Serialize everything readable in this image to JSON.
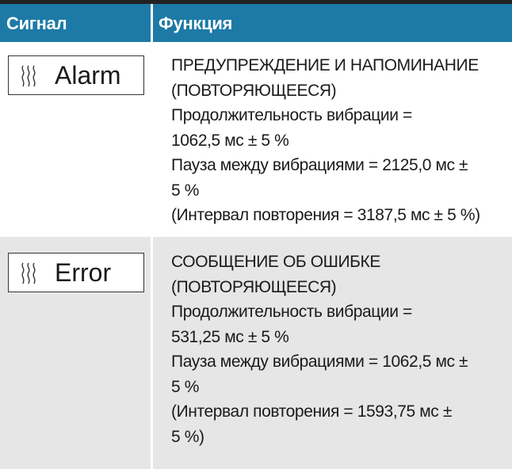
{
  "header": {
    "col_signal": "Сигнал",
    "col_function": "Функция"
  },
  "rows": [
    {
      "signal_icon": "vibration-icon",
      "signal_label": "Alarm",
      "lines": [
        "ПРЕДУПРЕЖДЕНИЕ И НАПОМИНАНИЕ",
        "(ПОВТОРЯЮЩЕЕСЯ)",
        "Продолжительность вибрации =",
        "1062,5 мс ± 5 %",
        "Пауза между вибрациями = 2125,0 мс ±",
        "5 %",
        "(Интервал повторения = 3187,5 мс ± 5 %)"
      ]
    },
    {
      "signal_icon": "vibration-icon",
      "signal_label": "Error",
      "lines": [
        "СООБЩЕНИЕ ОБ ОШИБКЕ",
        "(ПОВТОРЯЮЩЕЕСЯ)",
        "Продолжительность вибрации =",
        "531,25 мс ± 5 %",
        "Пауза между вибрациями = 1062,5 мс ±",
        "5 %",
        "(Интервал повторения = 1593,75 мс ±",
        "5 %)"
      ]
    }
  ],
  "colors": {
    "header_bg": "#1d7aa6",
    "row_alt_bg": "#e6e6e7",
    "top_rule": "#222222"
  }
}
